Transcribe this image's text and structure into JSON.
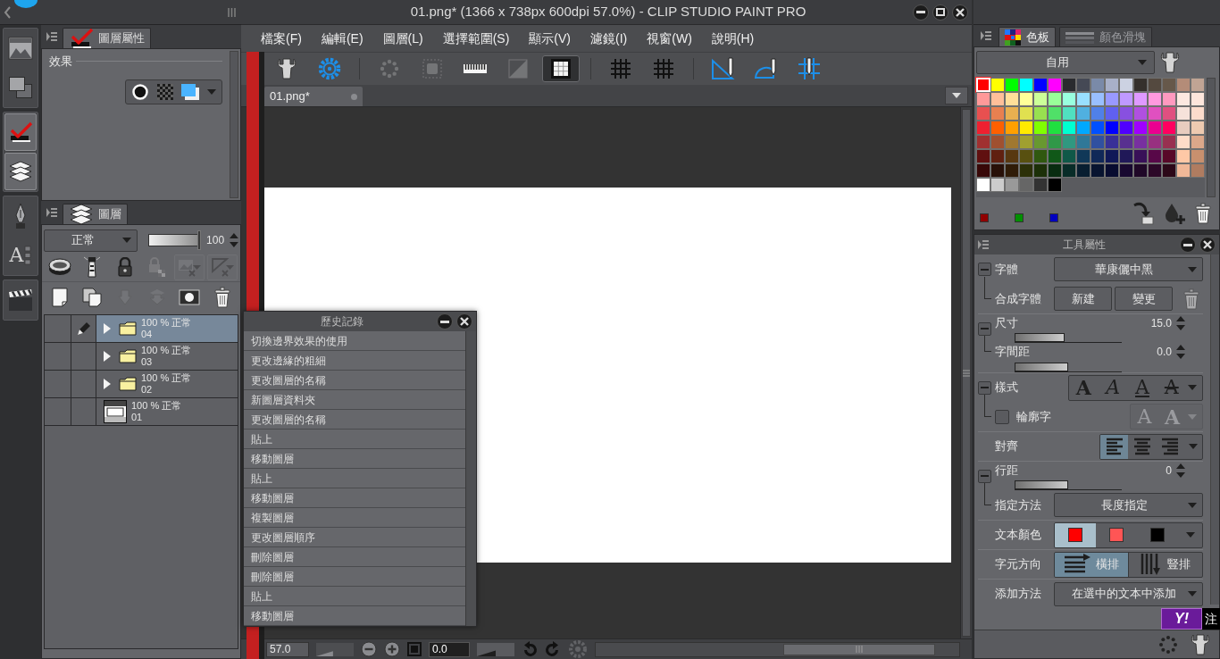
{
  "app": {
    "title": "01.png* (1366 x 738px 600dpi 57.0%) - CLIP STUDIO PAINT PRO"
  },
  "menu_bar": [
    "檔案(F)",
    "編輯(E)",
    "圖層(L)",
    "選擇範圍(S)",
    "顯示(V)",
    "濾鏡(I)",
    "視窗(W)",
    "說明(H)"
  ],
  "toolbar": [
    [
      {
        "selected": false,
        "disabled": false
      },
      {
        "selected": false,
        "disabled": false
      }
    ],
    [
      {
        "selected": false,
        "disabled": true
      },
      {
        "selected": false,
        "disabled": true
      },
      {
        "selected": false,
        "disabled": false
      },
      {
        "selected": false,
        "disabled": true
      },
      {
        "selected": true,
        "disabled": false
      }
    ],
    [
      {
        "selected": false,
        "disabled": false
      },
      {
        "selected": false,
        "disabled": false
      }
    ],
    [
      {
        "selected": false,
        "disabled": false
      },
      {
        "selected": false,
        "disabled": false
      },
      {
        "selected": false,
        "disabled": false
      }
    ]
  ],
  "left_rail": [
    {
      "selected": false
    },
    {
      "selected": false
    },
    {
      "selected": true
    },
    {
      "selected": true
    },
    {
      "selected": false
    },
    {
      "selected": false,
      "glyph": "A"
    },
    {
      "selected": false
    }
  ],
  "layer_property_panel": {
    "tab": "圖層屬性",
    "section": "效果"
  },
  "layer_panel": {
    "tab": "圖層",
    "blend_mode": "正常",
    "opacity": {
      "level": 1,
      "reading": "100"
    },
    "tool_rows": [
      [
        {
          "disabled": false
        },
        {
          "disabled": false
        },
        {
          "disabled": false
        },
        {
          "disabled": true
        },
        {
          "disabled": true
        },
        {
          "disabled": true
        }
      ],
      [
        {
          "disabled": false
        },
        {
          "disabled": false
        },
        {
          "disabled": true
        },
        {
          "disabled": true
        },
        {
          "disabled": false
        },
        {
          "disabled": false
        }
      ]
    ],
    "layers": [
      {
        "kind": "folder",
        "mode": "100 % 正常",
        "name": "04",
        "selected": true,
        "editing": true
      },
      {
        "kind": "folder",
        "mode": "100 % 正常",
        "name": "03",
        "selected": false,
        "editing": false
      },
      {
        "kind": "folder",
        "mode": "100 % 正常",
        "name": "02",
        "selected": false,
        "editing": false
      },
      {
        "kind": "raster",
        "mode": "100 % 正常",
        "name": "01",
        "selected": false,
        "editing": false
      }
    ]
  },
  "history_panel": {
    "title": "歷史記錄",
    "items": [
      "切換邊界效果的使用",
      "更改邊緣的粗細",
      "更改圖層的名稱",
      "新圖層資料夾",
      "更改圖層的名稱",
      "貼上",
      "移動圖層",
      "貼上",
      "移動圖層",
      "複製圖層",
      "更改圖層順序",
      "刪除圖層",
      "刪除圖層",
      "貼上",
      "移動圖層"
    ]
  },
  "document_tabs": [
    {
      "label": "01.png*",
      "selected": true
    }
  ],
  "status_bar": {
    "zoom": "57.0",
    "zoom_slider": {
      "level": 0.45
    },
    "rotation": "0.0",
    "rotation_slider": {
      "level": 0.5
    }
  },
  "color_panel": {
    "tabs": [
      {
        "label": "色板",
        "selected": true
      },
      {
        "label": "顏色滑塊",
        "selected": false
      }
    ],
    "preset": "自用",
    "swatches": [
      {
        "color": "#ff0000",
        "selected": true
      },
      {
        "color": "#ffff00",
        "selected": false
      },
      {
        "color": "#00ff00",
        "selected": false
      },
      {
        "color": "#00ffff",
        "selected": false
      },
      {
        "color": "#0000ff",
        "selected": false
      },
      {
        "color": "#ff00ff",
        "selected": false
      },
      {
        "color": "#2a2b2f",
        "selected": false
      },
      {
        "color": "#454955",
        "selected": false
      },
      {
        "color": "#7a8aa8",
        "selected": false
      },
      {
        "color": "#a8b0c8",
        "selected": false
      },
      {
        "color": "#ccd2e2",
        "selected": false
      },
      {
        "color": "#35302c",
        "selected": false
      },
      {
        "color": "#54493f",
        "selected": false
      },
      {
        "color": "#66584a",
        "selected": false
      },
      {
        "color": "#b48c78",
        "selected": false
      },
      {
        "color": "#c0a494",
        "selected": false
      },
      {
        "color": "#ff9999",
        "selected": false
      },
      {
        "color": "#ffbf99",
        "selected": false
      },
      {
        "color": "#ffdf99",
        "selected": false
      },
      {
        "color": "#ffff99",
        "selected": false
      },
      {
        "color": "#ccff99",
        "selected": false
      },
      {
        "color": "#99ff99",
        "selected": false
      },
      {
        "color": "#99ffdf",
        "selected": false
      },
      {
        "color": "#99dfff",
        "selected": false
      },
      {
        "color": "#99bfff",
        "selected": false
      },
      {
        "color": "#9999ff",
        "selected": false
      },
      {
        "color": "#bf99ff",
        "selected": false
      },
      {
        "color": "#df99ff",
        "selected": false
      },
      {
        "color": "#ff99df",
        "selected": false
      },
      {
        "color": "#ff99bf",
        "selected": false
      },
      {
        "color": "#fce8e0",
        "selected": false
      },
      {
        "color": "#fde6dc",
        "selected": false
      },
      {
        "color": "#e85050",
        "selected": false
      },
      {
        "color": "#e88050",
        "selected": false
      },
      {
        "color": "#e8b050",
        "selected": false
      },
      {
        "color": "#e0e050",
        "selected": false
      },
      {
        "color": "#98e050",
        "selected": false
      },
      {
        "color": "#50e068",
        "selected": false
      },
      {
        "color": "#50e0c0",
        "selected": false
      },
      {
        "color": "#50b0e0",
        "selected": false
      },
      {
        "color": "#5080e8",
        "selected": false
      },
      {
        "color": "#6060f0",
        "selected": false
      },
      {
        "color": "#8850e0",
        "selected": false
      },
      {
        "color": "#b050e0",
        "selected": false
      },
      {
        "color": "#e050c0",
        "selected": false
      },
      {
        "color": "#e05080",
        "selected": false
      },
      {
        "color": "#f6e2da",
        "selected": false
      },
      {
        "color": "#fcdccc",
        "selected": false
      },
      {
        "color": "#ee2030",
        "selected": false
      },
      {
        "color": "#ff6000",
        "selected": false
      },
      {
        "color": "#ffa000",
        "selected": false
      },
      {
        "color": "#ffea00",
        "selected": false
      },
      {
        "color": "#80ff00",
        "selected": false
      },
      {
        "color": "#20e040",
        "selected": false
      },
      {
        "color": "#00ffd0",
        "selected": false
      },
      {
        "color": "#00a8ff",
        "selected": false
      },
      {
        "color": "#0050ff",
        "selected": false
      },
      {
        "color": "#0000fe",
        "selected": false
      },
      {
        "color": "#5000ff",
        "selected": false
      },
      {
        "color": "#a000ff",
        "selected": false
      },
      {
        "color": "#ea0090",
        "selected": false
      },
      {
        "color": "#ff0060",
        "selected": false
      },
      {
        "color": "#e8ccbf",
        "selected": false
      },
      {
        "color": "#eecab0",
        "selected": false
      },
      {
        "color": "#a03030",
        "selected": false
      },
      {
        "color": "#a05030",
        "selected": false
      },
      {
        "color": "#a07830",
        "selected": false
      },
      {
        "color": "#a0a030",
        "selected": false
      },
      {
        "color": "#689830",
        "selected": false
      },
      {
        "color": "#309848",
        "selected": false
      },
      {
        "color": "#309880",
        "selected": false
      },
      {
        "color": "#307898",
        "selected": false
      },
      {
        "color": "#3050a0",
        "selected": false
      },
      {
        "color": "#383098",
        "selected": false
      },
      {
        "color": "#583090",
        "selected": false
      },
      {
        "color": "#7830a0",
        "selected": false
      },
      {
        "color": "#983080",
        "selected": false
      },
      {
        "color": "#983050",
        "selected": false
      },
      {
        "color": "#ffdcc8",
        "selected": false
      },
      {
        "color": "#dca88a",
        "selected": false
      },
      {
        "color": "#601010",
        "selected": false
      },
      {
        "color": "#602010",
        "selected": false
      },
      {
        "color": "#583810",
        "selected": false
      },
      {
        "color": "#585010",
        "selected": false
      },
      {
        "color": "#305810",
        "selected": false
      },
      {
        "color": "#105818",
        "selected": false
      },
      {
        "color": "#105848",
        "selected": false
      },
      {
        "color": "#103858",
        "selected": false
      },
      {
        "color": "#102858",
        "selected": false
      },
      {
        "color": "#101858",
        "selected": false
      },
      {
        "color": "#201858",
        "selected": false
      },
      {
        "color": "#381058",
        "selected": false
      },
      {
        "color": "#580848",
        "selected": false
      },
      {
        "color": "#580828",
        "selected": false
      },
      {
        "color": "#fec8a6",
        "selected": false
      },
      {
        "color": "#c8906e",
        "selected": false
      },
      {
        "color": "#380808",
        "selected": false
      },
      {
        "color": "#281008",
        "selected": false
      },
      {
        "color": "#301c08",
        "selected": false
      },
      {
        "color": "#2c3008",
        "selected": false
      },
      {
        "color": "#1c3008",
        "selected": false
      },
      {
        "color": "#082c10",
        "selected": false
      },
      {
        "color": "#082c28",
        "selected": false
      },
      {
        "color": "#081e30",
        "selected": false
      },
      {
        "color": "#081430",
        "selected": false
      },
      {
        "color": "#080c30",
        "selected": false
      },
      {
        "color": "#180830",
        "selected": false
      },
      {
        "color": "#200828",
        "selected": false
      },
      {
        "color": "#2c0828",
        "selected": false
      },
      {
        "color": "#2c0818",
        "selected": false
      },
      {
        "color": "#f0b898",
        "selected": false
      },
      {
        "color": "#b07c60",
        "selected": false
      },
      {
        "color": "#ffffff",
        "selected": false
      },
      {
        "color": "#cccccc",
        "selected": false
      },
      {
        "color": "#999999",
        "selected": false
      },
      {
        "color": "#666666",
        "selected": false
      },
      {
        "color": "#333333",
        "selected": false
      },
      {
        "color": "#000000",
        "selected": false
      }
    ],
    "chips": [
      {
        "color": "#900000"
      },
      {
        "color": "#009000"
      },
      {
        "color": "#0000c0"
      }
    ]
  },
  "tool_property_panel": {
    "title": "工具屬性",
    "rows": [
      {
        "kind": "dropdown",
        "label": "字體",
        "value": "華康儷中黑",
        "expanded": true,
        "children": [
          {
            "kind": "buttons",
            "label": "合成字體",
            "buttons": [
              "新建",
              "變更"
            ]
          }
        ]
      },
      {
        "kind": "slider",
        "label": "尺寸",
        "level": 0.47,
        "reading": "15.0",
        "expanded": true,
        "children": [
          {
            "kind": "slider",
            "label": "字間距",
            "level": 0.5,
            "reading": "0.0"
          }
        ]
      },
      {
        "kind": "styles",
        "label": "樣式",
        "options": [
          {
            "label": "A",
            "kind": "bold",
            "selected": false
          },
          {
            "label": "A",
            "kind": "italic",
            "selected": false
          },
          {
            "label": "A",
            "kind": "underline",
            "selected": false
          },
          {
            "label": "A",
            "kind": "strike",
            "selected": false
          }
        ],
        "expanded": true,
        "children": [
          {
            "kind": "checkbox",
            "label": "輪廓字",
            "checked": false,
            "options": [
              {
                "label": "A",
                "kind": "outline",
                "disabled": true
              },
              {
                "label": "A",
                "kind": "shadow",
                "disabled": true
              }
            ]
          }
        ]
      },
      {
        "kind": "align",
        "label": "對齊",
        "options": [
          {
            "selected": true
          },
          {
            "selected": false
          },
          {
            "selected": false
          }
        ]
      },
      {
        "kind": "slider",
        "label": "行距",
        "level": 0.5,
        "reading": "0",
        "expanded": true,
        "children": [
          {
            "kind": "dropdown",
            "label": "指定方法",
            "value": "長度指定"
          }
        ]
      },
      {
        "kind": "colors",
        "label": "文本顏色",
        "options": [
          {
            "color": "#ff0000",
            "selected": true
          },
          {
            "color": "#ff5555",
            "selected": false
          },
          {
            "color": "#000000",
            "selected": false
          }
        ]
      },
      {
        "kind": "direction",
        "label": "字元方向",
        "options": [
          {
            "label": "橫排",
            "selected": true
          },
          {
            "label": "豎排",
            "selected": false
          }
        ]
      },
      {
        "kind": "dropdown",
        "label": "添加方法",
        "value": "在選中的文本中添加"
      }
    ]
  },
  "ime_badge": {
    "logo": "Y!",
    "label": "注"
  }
}
